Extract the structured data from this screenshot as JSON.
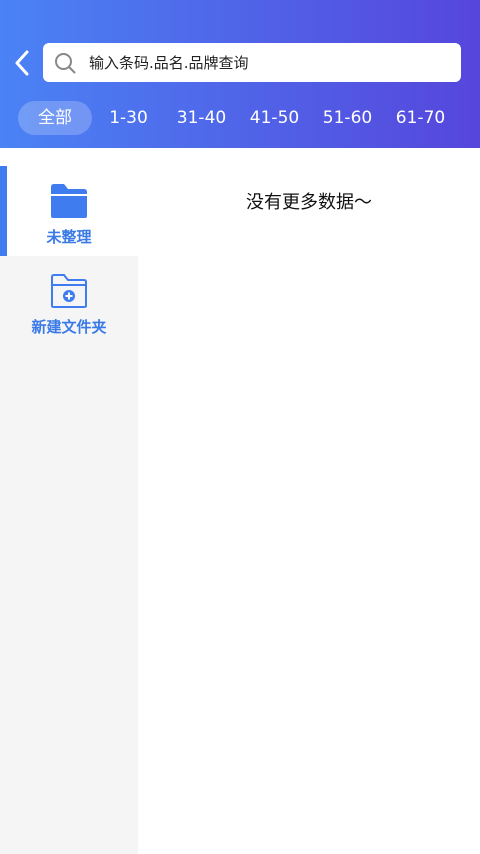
{
  "search": {
    "placeholder": "输入条码.品名.品牌查询"
  },
  "tabs": [
    {
      "label": "全部",
      "active": true
    },
    {
      "label": "1-30"
    },
    {
      "label": "31-40"
    },
    {
      "label": "41-50"
    },
    {
      "label": "51-60"
    },
    {
      "label": "61-70"
    }
  ],
  "sidebar": {
    "items": [
      {
        "label": "未整理",
        "icon": "folder-icon",
        "active": true
      },
      {
        "label": "新建文件夹",
        "icon": "folder-add-icon"
      }
    ]
  },
  "content": {
    "empty_text": "没有更多数据～"
  },
  "colors": {
    "header_start": "#4a83f5",
    "header_end": "#5646dc",
    "accent": "#3f7cf0",
    "sidebar_bg": "#f5f5f5"
  }
}
